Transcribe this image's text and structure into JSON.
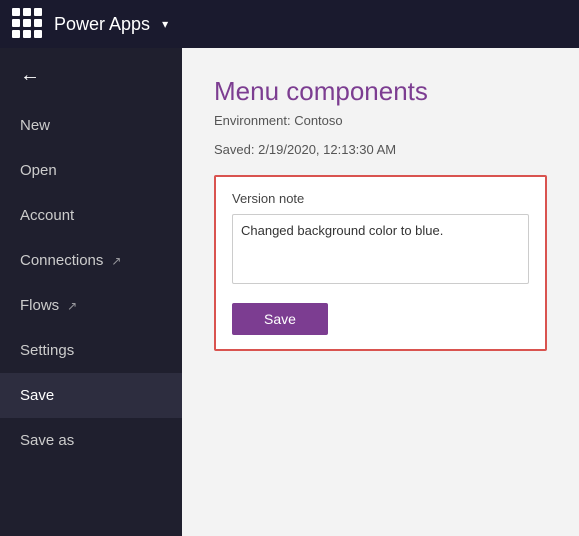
{
  "header": {
    "title": "Power Apps",
    "chevron": "▾"
  },
  "sidebar": {
    "back_label": "←",
    "items": [
      {
        "id": "new",
        "label": "New",
        "active": false,
        "ext": false
      },
      {
        "id": "open",
        "label": "Open",
        "active": false,
        "ext": false
      },
      {
        "id": "account",
        "label": "Account",
        "active": false,
        "ext": false
      },
      {
        "id": "connections",
        "label": "Connections",
        "active": false,
        "ext": true
      },
      {
        "id": "flows",
        "label": "Flows",
        "active": false,
        "ext": true
      },
      {
        "id": "settings",
        "label": "Settings",
        "active": false,
        "ext": false
      },
      {
        "id": "save",
        "label": "Save",
        "active": true,
        "ext": false
      },
      {
        "id": "save-as",
        "label": "Save as",
        "active": false,
        "ext": false
      }
    ]
  },
  "main": {
    "title": "Menu components",
    "environment": "Environment: Contoso",
    "saved": "Saved: 2/19/2020, 12:13:30 AM",
    "version_card": {
      "label": "Version note",
      "textarea_value": "Changed background color to blue.",
      "save_button": "Save"
    }
  }
}
